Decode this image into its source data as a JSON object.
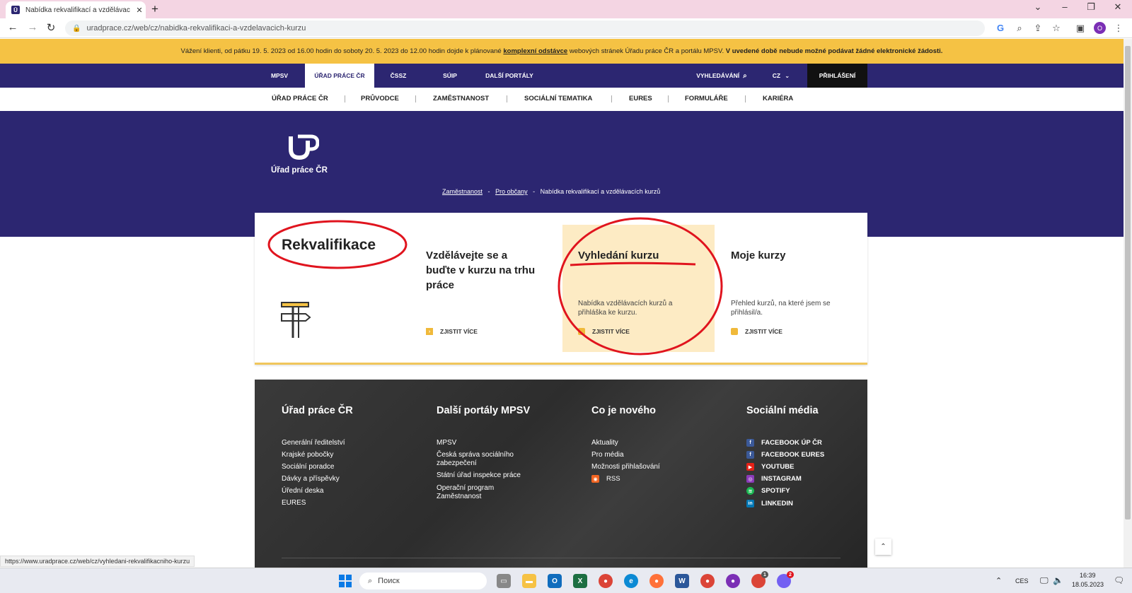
{
  "browser": {
    "tab_title": "Nabídka rekvalifikací a vzdělávac",
    "tab_favicon": "up-logo",
    "new_tab": "+",
    "close_tab": "✕",
    "url": "uradprace.cz/web/cz/nabidka-rekvalifikaci-a-vzdelavacich-kurzu",
    "profile_initial": "O",
    "status_url": "https://www.uradprace.cz/web/cz/vyhledani-rekvalifikacniho-kurzu"
  },
  "notice": {
    "text_pre": "Vážení klienti, od pátku 19. 5. 2023 od 16.00 hodin do soboty 20. 5. 2023 do 12.00 hodin dojde k plánované ",
    "link": "komplexní odstávce",
    "text_mid": " webových stránek Úřadu práce ČR a portálu MPSV. ",
    "text_bold": "V uvedené době nebude možné podávat žádné elektronické žádosti."
  },
  "topnav": {
    "items": [
      "MPSV",
      "ÚŘAD PRÁCE ČR",
      "ČSSZ",
      "SÚIP",
      "DALŠÍ PORTÁLY"
    ],
    "search": "VYHLEDÁVÁNÍ",
    "lang": "CZ",
    "login": "PŘIHLÁŠENÍ"
  },
  "subnav": {
    "items": [
      "ÚŘAD PRÁCE ČR",
      "PRŮVODCE",
      "ZAMĚSTNANOST",
      "SOCIÁLNÍ TEMATIKA",
      "EURES",
      "FORMULÁŘE",
      "KARIÉRA"
    ]
  },
  "hero": {
    "logo_text": "Úřad práce ČR",
    "breadcrumb": [
      "Zaměstnanost",
      "Pro občany",
      "Nabídka rekvalifikací a vzdělávacích kurzů"
    ],
    "crumb_sep": "-"
  },
  "card": {
    "title": "Rekvalifikace",
    "columns": [
      {
        "title": "Vzdělávejte se a buďte v kurzu na trhu práce",
        "desc": "",
        "link": "ZJISTIT VÍCE"
      },
      {
        "title": "Vyhledání kurzu",
        "desc": "Nabídka vzdělávacích kurzů a přihláška ke kurzu.",
        "link": "ZJISTIT VÍCE"
      },
      {
        "title": "Moje kurzy",
        "desc": "Přehled kurzů, na které jsem se přihlásil/a.",
        "link": "ZJISTIT VÍCE"
      }
    ]
  },
  "footer": {
    "columns": [
      {
        "title": "Úřad práce ČR",
        "items": [
          "Generální ředitelství",
          "Krajské pobočky",
          "Sociální poradce",
          "Dávky a příspěvky",
          "Úřední deska",
          "EURES"
        ]
      },
      {
        "title": "Další portály MPSV",
        "items": [
          "MPSV",
          "Česká správa sociálního zabezpečení",
          "Státní úřad inspekce práce",
          "Operační program Zaměstnanost"
        ]
      },
      {
        "title": "Co je nového",
        "items": [
          "Aktuality",
          "Pro média",
          "Možnosti přihlašování",
          "RSS"
        ]
      },
      {
        "title": "Sociální média",
        "items": [
          "FACEBOOK ÚP ČR",
          "FACEBOOK EURES",
          "YOUTUBE",
          "INSTAGRAM",
          "SPOTIFY",
          "LINKEDIN"
        ]
      }
    ]
  },
  "taskbar": {
    "search": "Поиск",
    "lang": "CES",
    "time": "16:39",
    "date": "18.05.2023",
    "badge_chrome": "1",
    "badge_viber": "2"
  },
  "colors": {
    "brand": "#2c2671",
    "notice": "#f5c244",
    "highlight": "#fdebc4",
    "annotation": "#e0141e"
  }
}
